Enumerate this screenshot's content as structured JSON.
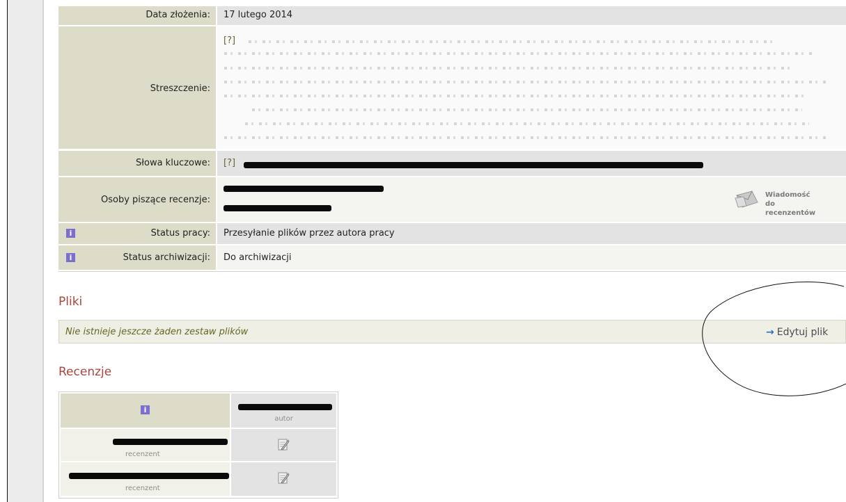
{
  "details": {
    "date_label": "Data złożenia:",
    "date_value": "17 lutego 2014",
    "abstract_label": "Streszczenie:",
    "abstract_hint": "[?]",
    "keywords_label": "Słowa kluczowe:",
    "keywords_hint": "[?]",
    "reviewers_label": "Osoby piszące recenzje:",
    "message_reviewers": "Wiadomość do recenzentów",
    "status_label": "Status pracy:",
    "status_value": "Przesyłanie plików przez autora pracy",
    "archive_label": "Status archiwizacji:",
    "archive_value": "Do archiwizacji"
  },
  "files": {
    "title": "Pliki",
    "empty_message": "Nie istnieje jeszcze żaden zestaw plików",
    "edit_link": "Edytuj plik"
  },
  "reviews": {
    "title": "Recenzje",
    "author_role": "autor",
    "reviewer_role_1": "recenzent",
    "reviewer_role_2": "recenzent"
  },
  "icons": {
    "info": "info-icon",
    "envelope": "envelope-icon",
    "arrow": "arrow-right-icon",
    "review_doc": "review-document-icon"
  },
  "colors": {
    "label_bg": "#dcdcc9",
    "section_title": "#a6463e",
    "link": "#3b55a8",
    "info_icon": "#7b6fd0"
  }
}
